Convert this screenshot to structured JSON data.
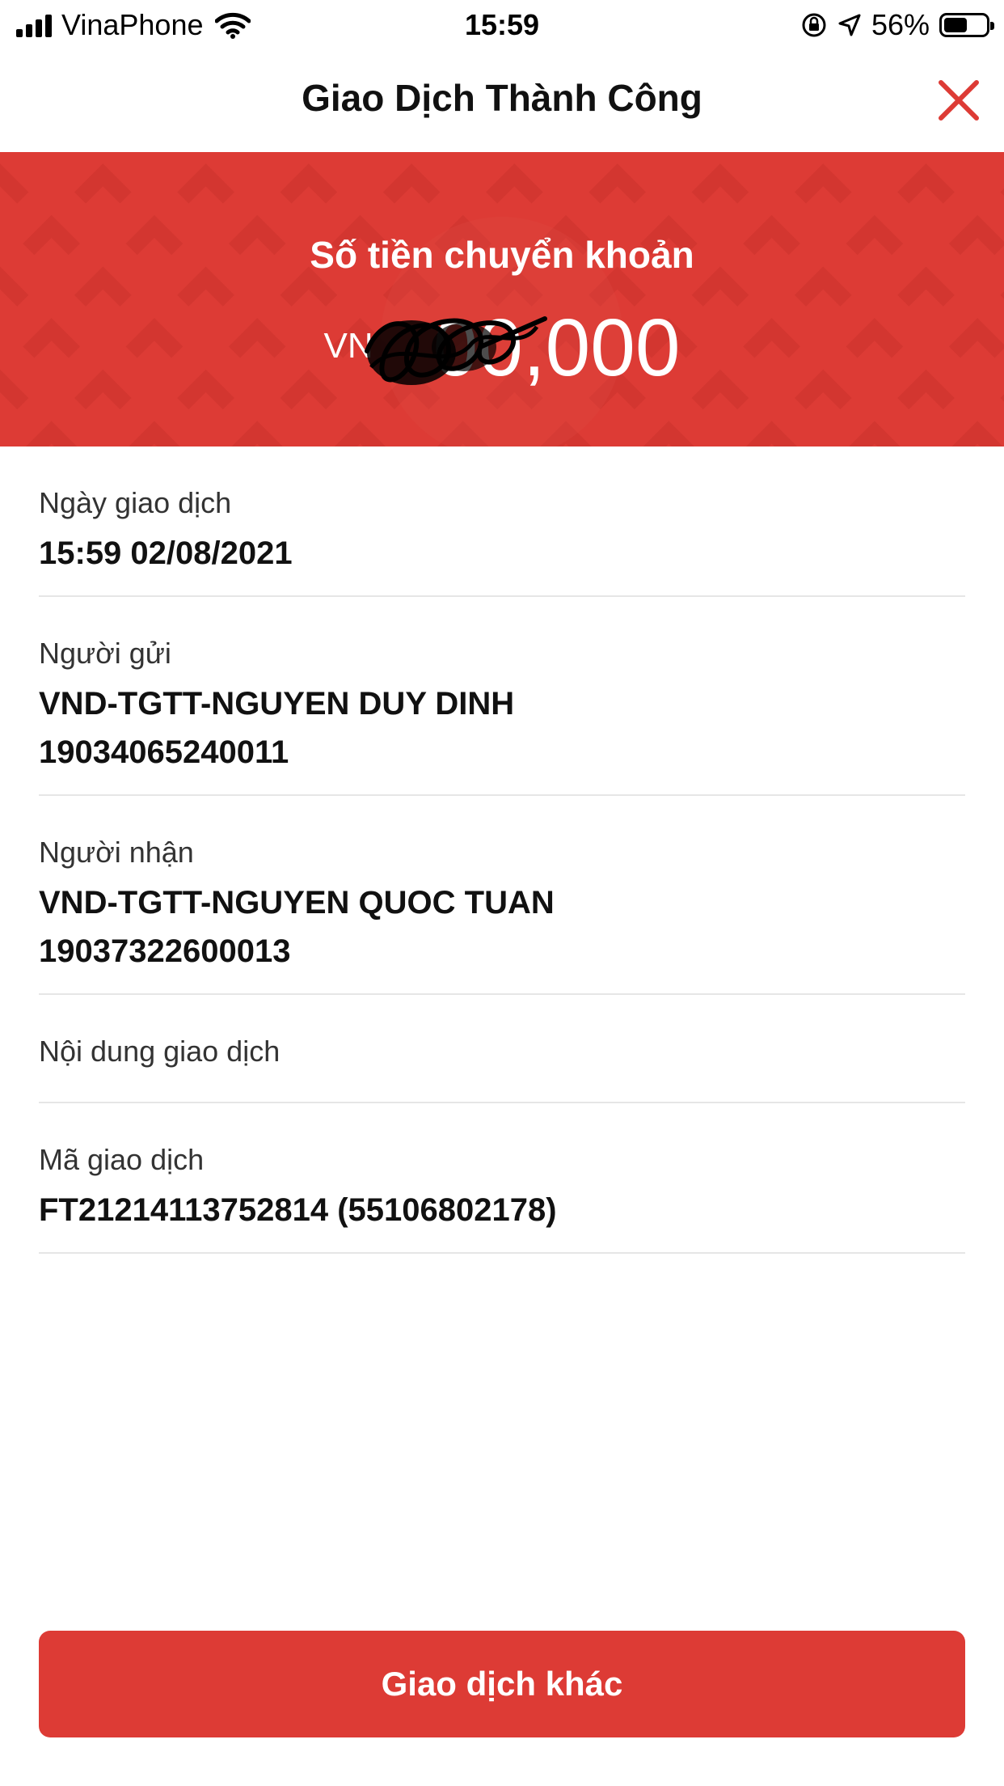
{
  "status_bar": {
    "carrier": "VinaPhone",
    "time": "15:59",
    "battery": "56%",
    "battery_level": 0.56
  },
  "header": {
    "title": "Giao Dịch Thành Công"
  },
  "banner": {
    "label": "Số tiền chuyển khoản",
    "currency": "VN",
    "amount": "00,000"
  },
  "details": {
    "date": {
      "label": "Ngày giao dịch",
      "value": "15:59 02/08/2021"
    },
    "sender": {
      "label": "Người gửi",
      "name": "VND-TGTT-NGUYEN DUY DINH",
      "account": "19034065240011"
    },
    "receiver": {
      "label": "Người nhận",
      "name": "VND-TGTT-NGUYEN QUOC TUAN",
      "account": "19037322600013"
    },
    "content": {
      "label": "Nội dung giao dịch",
      "value": ""
    },
    "code": {
      "label": "Mã giao dịch",
      "value": "FT21214113752814 (55106802178)"
    }
  },
  "actions": {
    "other_transaction": "Giao dịch khác"
  },
  "colors": {
    "accent": "#dd3b35"
  },
  "icons": [
    "signal-icon",
    "wifi-icon",
    "orientation-lock-icon",
    "location-icon",
    "battery-icon",
    "close-icon"
  ]
}
